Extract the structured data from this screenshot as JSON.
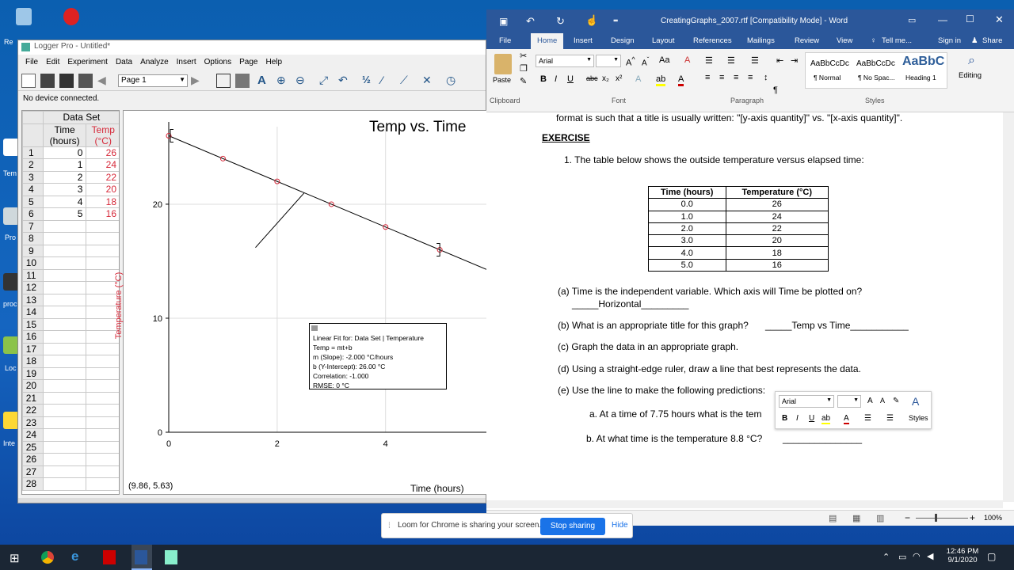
{
  "desktop": {
    "icons": [
      {
        "label": "Re"
      },
      {
        "label": "Tem"
      },
      {
        "label": "Pro"
      },
      {
        "label": "proc"
      },
      {
        "label": "Loc"
      },
      {
        "label": "Inte"
      }
    ]
  },
  "logger": {
    "title": "Logger Pro - Untitled*",
    "menu": [
      "File",
      "Edit",
      "Experiment",
      "Data",
      "Analyze",
      "Insert",
      "Options",
      "Page",
      "Help"
    ],
    "page_select": "Page 1",
    "status": "No device connected.",
    "table": {
      "set_name": "Data Set",
      "col_time": "Time",
      "col_time_unit": "(hours)",
      "col_temp": "Temp",
      "col_temp_unit": "(°C)",
      "rows": [
        [
          "1",
          "0",
          "26"
        ],
        [
          "2",
          "1",
          "24"
        ],
        [
          "3",
          "2",
          "22"
        ],
        [
          "4",
          "3",
          "20"
        ],
        [
          "5",
          "4",
          "18"
        ],
        [
          "6",
          "5",
          "16"
        ],
        [
          "7",
          "",
          ""
        ],
        [
          "8",
          "",
          ""
        ],
        [
          "9",
          "",
          ""
        ],
        [
          "10",
          "",
          ""
        ],
        [
          "11",
          "",
          ""
        ],
        [
          "12",
          "",
          ""
        ],
        [
          "13",
          "",
          ""
        ],
        [
          "14",
          "",
          ""
        ],
        [
          "15",
          "",
          ""
        ],
        [
          "16",
          "",
          ""
        ],
        [
          "17",
          "",
          ""
        ],
        [
          "18",
          "",
          ""
        ],
        [
          "19",
          "",
          ""
        ],
        [
          "20",
          "",
          ""
        ],
        [
          "21",
          "",
          ""
        ],
        [
          "22",
          "",
          ""
        ],
        [
          "23",
          "",
          ""
        ],
        [
          "24",
          "",
          ""
        ],
        [
          "25",
          "",
          ""
        ],
        [
          "26",
          "",
          ""
        ],
        [
          "27",
          "",
          ""
        ],
        [
          "28",
          "",
          ""
        ]
      ]
    },
    "graph": {
      "title": "Temp vs. Time",
      "ylabel": "Temperature (°C)",
      "xlabel": "Time (hours)",
      "coords": "(9.86, 5.63)",
      "yticks": [
        "20",
        "10",
        "0"
      ],
      "xticks": [
        "0",
        "2",
        "4"
      ]
    },
    "fit": {
      "header": "Linear Fit for: Data Set | Temperature",
      "eq": "Temp = mt+b",
      "slope": "m (Slope): -2.000 °C/hours",
      "intercept": "b (Y-Intercept): 26.00 °C",
      "corr": "Correlation: -1.000",
      "rmse": "RMSE: 0 °C"
    }
  },
  "chart_data": {
    "type": "scatter",
    "title": "Temp vs. Time",
    "xlabel": "Time (hours)",
    "ylabel": "Temperature (°C)",
    "x": [
      0,
      1,
      2,
      3,
      4,
      5
    ],
    "y": [
      26,
      24,
      22,
      20,
      18,
      16
    ],
    "xlim": [
      0,
      5.86
    ],
    "ylim": [
      0,
      26.8
    ],
    "fit_line": {
      "slope": -2.0,
      "intercept": 26.0
    },
    "grid": true,
    "point_color": "#d62839",
    "line_color": "#000000"
  },
  "word": {
    "title": "CreatingGraphs_2007.rtf [Compatibility Mode] - Word",
    "tabs": [
      "File",
      "Home",
      "Insert",
      "Design",
      "Layout",
      "References",
      "Mailings",
      "Review",
      "View"
    ],
    "tell_me": "Tell me...",
    "sign_in": "Sign in",
    "share": "Share",
    "font": "Arial",
    "paste": "Paste",
    "clipboard": "Clipboard",
    "font_group": "Font",
    "paragraph": "Paragraph",
    "styles": "Styles",
    "editing": "Editing",
    "style_items": [
      {
        "preview": "AaBbCcDc",
        "name": "¶ Normal"
      },
      {
        "preview": "AaBbCcDc",
        "name": "¶ No Spac..."
      },
      {
        "preview": "AaBbC",
        "name": "Heading 1"
      }
    ],
    "doc": {
      "intro1": "format is such that a title is usually written: \"[y-axis quantity]\" vs. \"[x-axis quantity]\".",
      "exercise": "EXERCISE",
      "q1": "1.   The table below shows the outside temperature versus elapsed time:",
      "th_time": "Time (hours)",
      "th_temp": "Temperature (°C)",
      "rows": [
        [
          "0.0",
          "26"
        ],
        [
          "1.0",
          "24"
        ],
        [
          "2.0",
          "22"
        ],
        [
          "3.0",
          "20"
        ],
        [
          "4.0",
          "18"
        ],
        [
          "5.0",
          "16"
        ]
      ],
      "a": "(a) Time is the independent variable. Which axis will Time be plotted on?",
      "a_ans": "_____Horizontal_________",
      "b": "(b) What is an appropriate title for this graph?",
      "b_ans": "_____Temp vs Time___________",
      "c": "(c) Graph the data in an appropriate graph.",
      "d": "(d) Using a straight-edge ruler, draw a line that best represents the data.",
      "e": "(e) Use the line to make the following predictions:",
      "ea": "a.   At a time of 7.75 hours what is the tem",
      "eb": "b.   At what time is the temperature 8.8 °C?",
      "eb_line": "_______________"
    },
    "zoom": "100%",
    "mini_font": "Arial",
    "mini_styles": "Styles"
  },
  "loom": {
    "text": "Loom for Chrome is sharing your screen.",
    "stop": "Stop sharing",
    "hide": "Hide"
  },
  "taskbar": {
    "time": "12:46 PM",
    "date": "9/1/2020"
  }
}
